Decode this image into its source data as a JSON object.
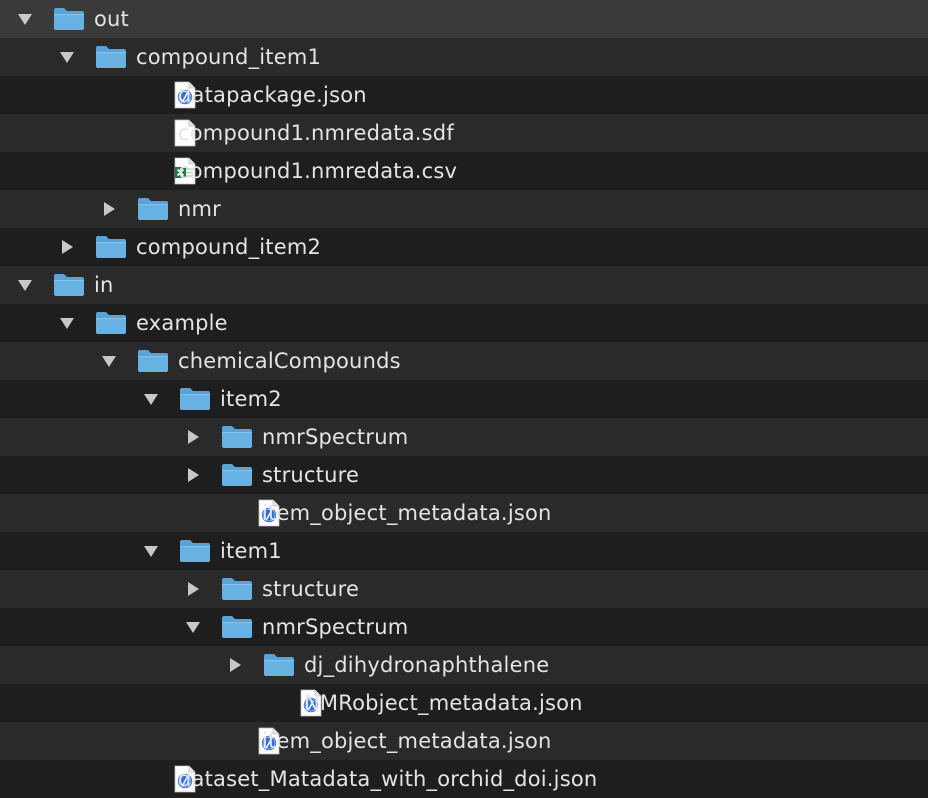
{
  "colors": {
    "row_even": "#1e1e1e",
    "row_odd": "#2a2a2a",
    "row_selected": "#3a3a3a",
    "text": "#e4e4e4",
    "folder": "#67b1e3",
    "folder_tab": "#5aa3d6",
    "disclosure": "#c8c8c8"
  },
  "rows": [
    {
      "label": "out",
      "type": "folder",
      "state": "expanded",
      "depth": 0
    },
    {
      "label": "compound_item1",
      "type": "folder",
      "state": "expanded",
      "depth": 1
    },
    {
      "label": "datapackage.json",
      "type": "json-file",
      "state": "none",
      "depth": 2
    },
    {
      "label": "compound1.nmredata.sdf",
      "type": "blank-file",
      "state": "none",
      "depth": 2
    },
    {
      "label": "compound1.nmredata.csv",
      "type": "excel-file",
      "state": "none",
      "depth": 2
    },
    {
      "label": "nmr",
      "type": "folder",
      "state": "collapsed",
      "depth": 2
    },
    {
      "label": "compound_item2",
      "type": "folder",
      "state": "collapsed",
      "depth": 1
    },
    {
      "label": "in",
      "type": "folder",
      "state": "expanded",
      "depth": 0
    },
    {
      "label": "example",
      "type": "folder",
      "state": "expanded",
      "depth": 1
    },
    {
      "label": "chemicalCompounds",
      "type": "folder",
      "state": "expanded",
      "depth": 2
    },
    {
      "label": "item2",
      "type": "folder",
      "state": "expanded",
      "depth": 3
    },
    {
      "label": "nmrSpectrum",
      "type": "folder",
      "state": "collapsed",
      "depth": 4
    },
    {
      "label": "structure",
      "type": "folder",
      "state": "collapsed",
      "depth": 4
    },
    {
      "label": "item_object_metadata.json",
      "type": "json-file",
      "state": "none",
      "depth": 4
    },
    {
      "label": "item1",
      "type": "folder",
      "state": "expanded",
      "depth": 3
    },
    {
      "label": "structure",
      "type": "folder",
      "state": "collapsed",
      "depth": 4
    },
    {
      "label": "nmrSpectrum",
      "type": "folder",
      "state": "expanded",
      "depth": 4
    },
    {
      "label": "dj_dihydronaphthalene",
      "type": "folder",
      "state": "collapsed",
      "depth": 5
    },
    {
      "label": "NMRobject_metadata.json",
      "type": "json-file",
      "state": "none",
      "depth": 5
    },
    {
      "label": "item_object_metadata.json",
      "type": "json-file",
      "state": "none",
      "depth": 4
    },
    {
      "label": "dataset_Matadata_with_orchid_doi.json",
      "type": "json-file",
      "state": "none",
      "depth": 2
    }
  ]
}
